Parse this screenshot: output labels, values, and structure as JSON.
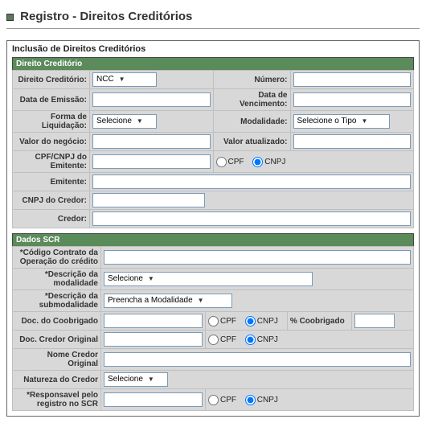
{
  "title": "Registro - Direitos Creditórios",
  "subtitle": "Inclusão de Direitos Creditórios",
  "sections": {
    "direito": {
      "header": "Direito Creditório",
      "direito_label": "Direito Creditório:",
      "direito_value": "NCC",
      "numero_label": "Número:",
      "numero_value": "",
      "data_emissao_label": "Data de Emissão:",
      "data_emissao_value": "",
      "data_venc_label": "Data de Vencimento:",
      "data_venc_value": "",
      "forma_liq_label": "Forma de Liquidação:",
      "forma_liq_value": "Selecione",
      "modalidade_label": "Modalidade:",
      "modalidade_value": "Selecione o Tipo",
      "valor_neg_label": "Valor do negócio:",
      "valor_neg_value": "",
      "valor_atu_label": "Valor atualizado:",
      "valor_atu_value": "",
      "cpfcnpj_emit_label": "CPF/CNPJ do Emitente:",
      "cpfcnpj_emit_value": "",
      "emitente_label": "Emitente:",
      "emitente_value": "",
      "cnpj_credor_label": "CNPJ do Credor:",
      "cnpj_credor_value": "",
      "credor_label": "Credor:",
      "credor_value": ""
    },
    "scr": {
      "header": "Dados SCR",
      "codigo_label": "*Código Contrato da Operação do crédito",
      "codigo_value": "",
      "desc_mod_label": "*Descrição da modalidade",
      "desc_mod_value": "Selecione",
      "desc_submod_label": "*Descrição da submodalidade",
      "desc_submod_value": "Preencha a Modalidade",
      "doc_coob_label": "Doc. do Coobrigado",
      "doc_coob_value": "",
      "pct_coob_label": "% Coobrigado",
      "pct_coob_value": "",
      "doc_credor_orig_label": "Doc. Credor Original",
      "doc_credor_orig_value": "",
      "nome_credor_orig_label": "Nome Credor Original",
      "nome_credor_orig_value": "",
      "natureza_label": "Natureza do Credor",
      "natureza_value": "Selecione",
      "resp_label": "*Responsavel pelo registro no SCR",
      "resp_value": ""
    }
  },
  "radio": {
    "cpf": "CPF",
    "cnpj": "CNPJ"
  }
}
